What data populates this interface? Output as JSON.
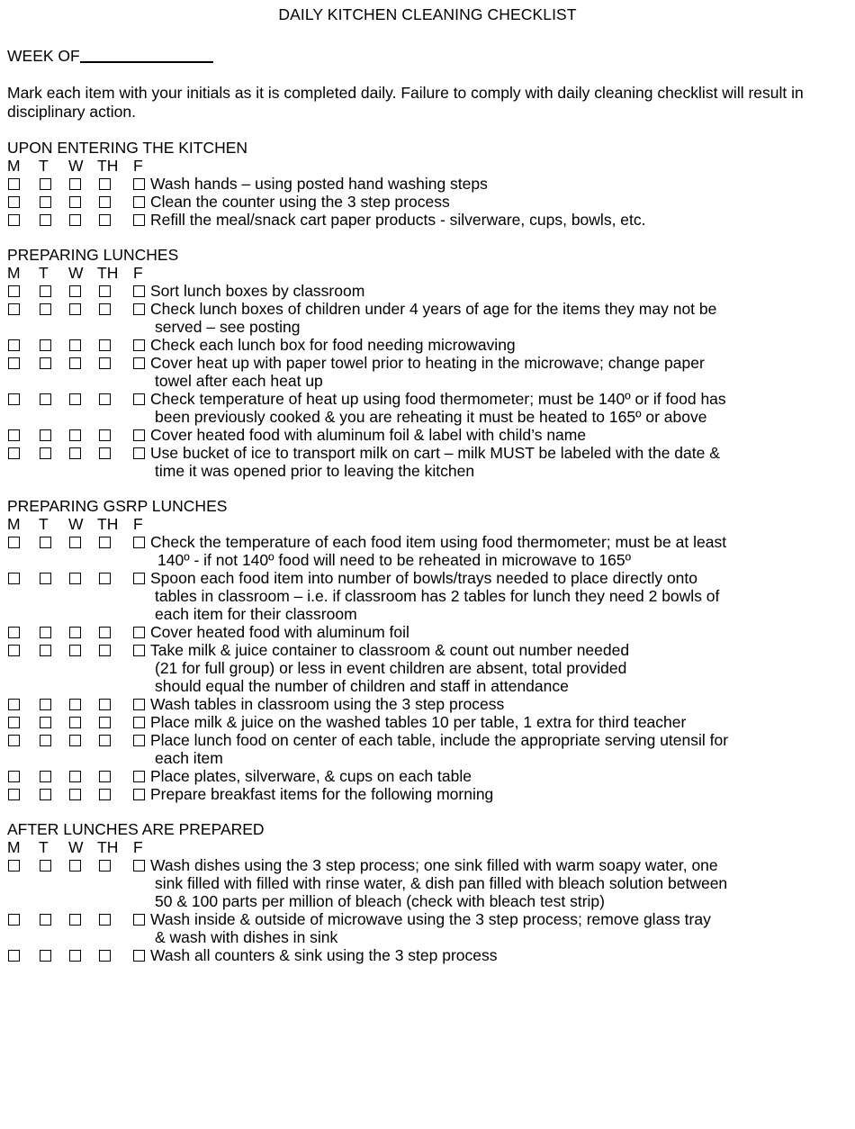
{
  "document": {
    "title": "DAILY KITCHEN CLEANING CHECKLIST",
    "week_of_label": "WEEK OF",
    "instructions": "Mark each item with your initials as it is completed daily.  Failure to comply with daily cleaning checklist will result in disciplinary action."
  },
  "day_columns": [
    "M",
    "T",
    "W",
    "TH",
    "F"
  ],
  "sections": [
    {
      "title": "UPON ENTERING THE KITCHEN",
      "items": [
        {
          "text": "Wash hands – using posted hand washing steps",
          "continuations": []
        },
        {
          "text": "Clean the counter using the 3 step process",
          "continuations": []
        },
        {
          "text": "Refill the meal/snack cart paper products - silverware, cups, bowls, etc.",
          "continuations": []
        }
      ]
    },
    {
      "title": "PREPARING LUNCHES",
      "items": [
        {
          "text": "Sort lunch boxes by classroom",
          "continuations": []
        },
        {
          "text": "Check lunch boxes of children under 4 years of age for the items they may not be",
          "continuations": [
            "served – see posting"
          ]
        },
        {
          "text": "Check each lunch box for food needing microwaving",
          "continuations": []
        },
        {
          "text": "Cover heat up with paper towel prior to heating in the microwave; change paper",
          "continuations": [
            "towel after each heat up"
          ]
        },
        {
          "text": "Check temperature of heat up using food thermometer; must be 140º or if food has",
          "continuations": [
            "been previously cooked & you are reheating it must be heated to 165º or above"
          ]
        },
        {
          "text": "Cover heated food with aluminum foil & label with child’s name",
          "continuations": []
        },
        {
          "text": "Use bucket of ice to transport milk on cart – milk MUST be labeled with the date &",
          "continuations": [
            "time it was opened prior to leaving the kitchen"
          ]
        }
      ]
    },
    {
      "title": "PREPARING GSRP LUNCHES",
      "items": [
        {
          "text": "Check the temperature of each food item using food thermometer; must be at least",
          "continuations": [
            "140º - if not 140º food will need to be reheated in microwave to 165º"
          ]
        },
        {
          "text": "Spoon each food item into number of bowls/trays needed to place directly onto",
          "continuations": [
            "tables in classroom – i.e. if classroom has 2 tables for lunch they need 2 bowls of",
            "each item for their classroom"
          ]
        },
        {
          "text": "Cover heated food with aluminum foil",
          "continuations": []
        },
        {
          "text": "Take milk & juice container to classroom & count out number needed",
          "continuations": [
            "(21 for full group) or less in event children are absent, total provided",
            "should equal the number of children and staff in attendance"
          ]
        },
        {
          "text": "Wash tables in classroom using the 3 step process",
          "continuations": []
        },
        {
          "text": "Place milk & juice on the washed tables 10 per table, 1 extra for third teacher",
          "continuations": []
        },
        {
          "text": "Place lunch food on center of each table, include the appropriate serving utensil for",
          "continuations": [
            "each item"
          ]
        },
        {
          "text": "Place plates, silverware, & cups on each table",
          "continuations": []
        },
        {
          "text": "Prepare breakfast items for the following morning",
          "continuations": []
        }
      ]
    },
    {
      "title": "AFTER LUNCHES ARE PREPARED",
      "items": [
        {
          "text": "Wash dishes using the 3 step process; one sink filled with warm soapy water, one",
          "continuations": [
            "sink filled with filled with rinse water, & dish pan filled with bleach solution between",
            "50 & 100 parts per million of bleach (check with bleach test strip)"
          ]
        },
        {
          "text": "Wash inside & outside of microwave using the 3 step process; remove glass tray",
          "continuations": [
            "& wash with dishes in sink"
          ]
        },
        {
          "text": "Wash all counters & sink using the 3 step process",
          "continuations": []
        }
      ]
    }
  ]
}
